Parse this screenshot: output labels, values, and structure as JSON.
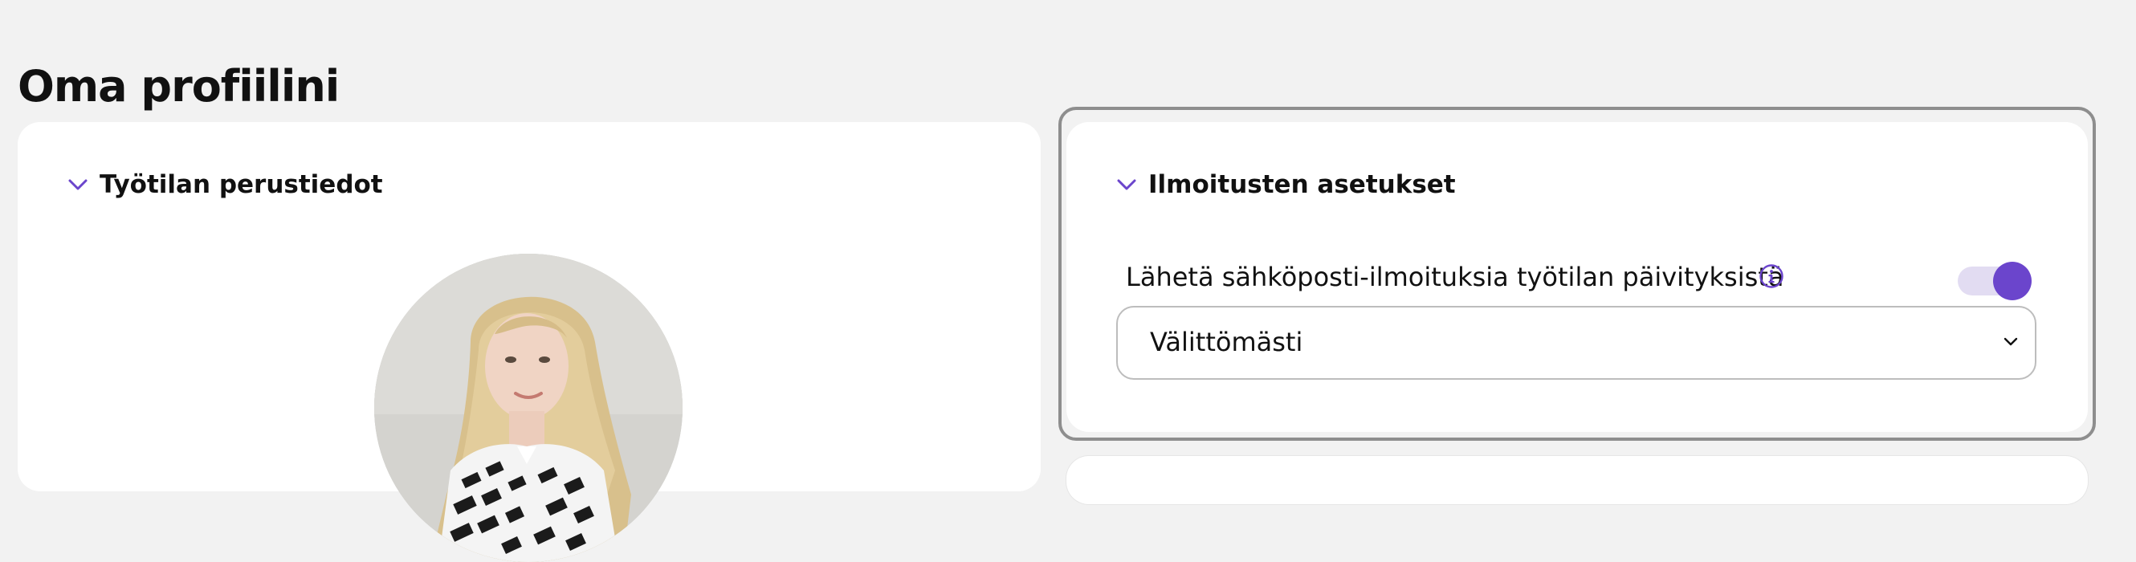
{
  "page": {
    "title": "Oma profiilini"
  },
  "workspace_basics": {
    "header_label": "Työtilan perustiedot",
    "avatar_alt": "Profiilikuva"
  },
  "notification_settings": {
    "header_label": "Ilmoitusten asetukset",
    "email_toggle": {
      "label": "Lähetä sähköposti-ilmoituksia työtilan päivityksistä",
      "enabled": true
    },
    "frequency_select": {
      "value": "Välittömästi"
    }
  },
  "icons": {
    "chevron": "chevron-down-icon",
    "info": "info-icon",
    "select_caret": "select-caret-icon"
  },
  "colors": {
    "accent": "#6b45cc",
    "accent_light": "#e2dcf2",
    "background": "#f2f2f2",
    "card": "#ffffff",
    "outline": "#8e8e8e"
  }
}
